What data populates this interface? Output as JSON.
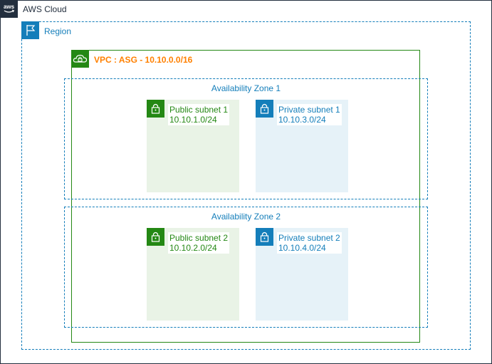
{
  "cloud": {
    "label": "AWS Cloud",
    "icon": "aws-logo-icon",
    "color": "#232f3e"
  },
  "region": {
    "label": "Region",
    "icon": "region-flag-icon",
    "color": "#147eba"
  },
  "vpc": {
    "label": "VPC : ASG - 10.10.0.0/16",
    "icon": "vpc-cloud-lock-icon",
    "color": "#248814",
    "label_color": "#ff8000"
  },
  "zones": [
    {
      "label": "Availability Zone 1",
      "public_subnet": {
        "name": "Public subnet 1",
        "cidr": "10.10.1.0/24"
      },
      "private_subnet": {
        "name": "Private subnet 1",
        "cidr": "10.10.3.0/24"
      }
    },
    {
      "label": "Availability Zone 2",
      "public_subnet": {
        "name": "Public subnet 2",
        "cidr": "10.10.2.0/24"
      },
      "private_subnet": {
        "name": "Private subnet 2",
        "cidr": "10.10.4.0/24"
      }
    }
  ],
  "colors": {
    "public": "#248814",
    "private": "#147eba",
    "public_fill": "#e9f3e6",
    "private_fill": "#e6f2f8"
  }
}
